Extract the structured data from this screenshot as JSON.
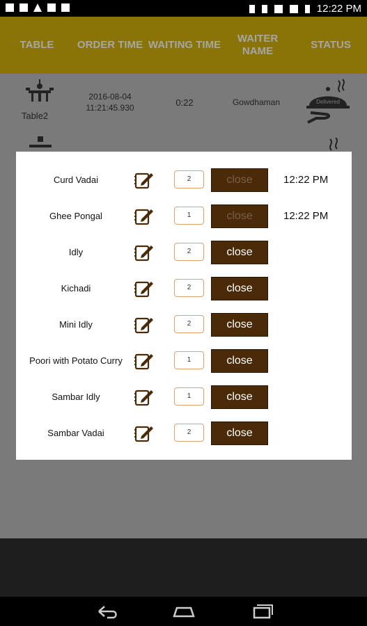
{
  "status_bar": {
    "time": "12:22 PM"
  },
  "header": {
    "columns": [
      "TABLE",
      "ORDER TIME",
      "WAITING TIME",
      "WAITER NAME",
      "STATUS"
    ]
  },
  "orders": [
    {
      "table": "Table2",
      "order_time_date": "2016-08-04",
      "order_time_clock": "11:21:45.930",
      "waiting_time": "0:22",
      "waiter": "Gowdhaman",
      "status": "Delivered"
    }
  ],
  "modal": {
    "items": [
      {
        "name": "Curd Vadai",
        "qty": "2",
        "close_label": "close",
        "closed": true,
        "time": "12:22 PM"
      },
      {
        "name": "Ghee Pongal",
        "qty": "1",
        "close_label": "close",
        "closed": true,
        "time": "12:22 PM"
      },
      {
        "name": "Idly",
        "qty": "2",
        "close_label": "close",
        "closed": false,
        "time": ""
      },
      {
        "name": "Kichadi",
        "qty": "2",
        "close_label": "close",
        "closed": false,
        "time": ""
      },
      {
        "name": "Mini Idly",
        "qty": "2",
        "close_label": "close",
        "closed": false,
        "time": ""
      },
      {
        "name": "Poori with Potato Curry",
        "qty": "1",
        "close_label": "close",
        "closed": false,
        "time": ""
      },
      {
        "name": "Sambar Idly",
        "qty": "1",
        "close_label": "close",
        "closed": false,
        "time": ""
      },
      {
        "name": "Sambar Vadai",
        "qty": "2",
        "close_label": "close",
        "closed": false,
        "time": ""
      }
    ]
  },
  "colors": {
    "header_bg": "#d4af0f",
    "button_bg": "#4a2a08",
    "qty_border": "#e0a070"
  }
}
